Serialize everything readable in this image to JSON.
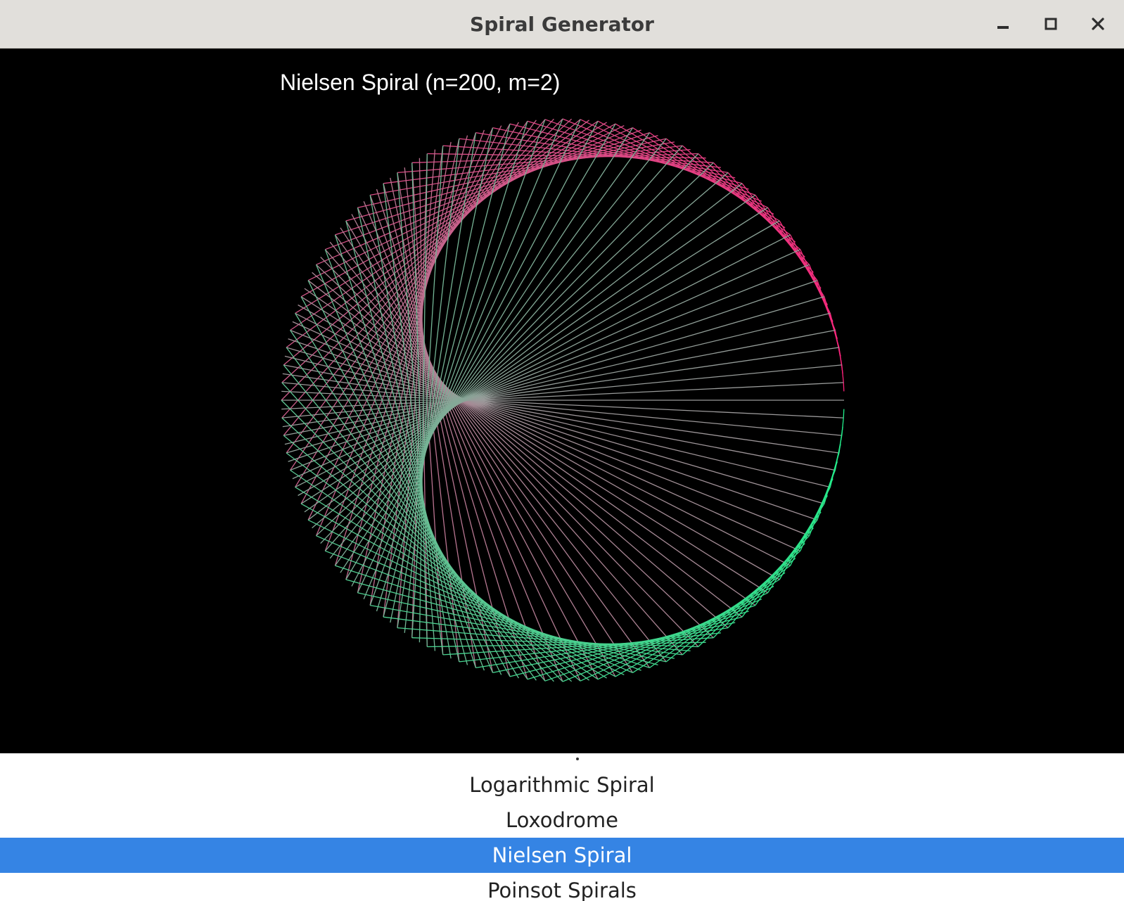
{
  "window": {
    "title": "Spiral Generator"
  },
  "window_controls": [
    "minimize",
    "maximize",
    "close"
  ],
  "canvas": {
    "title": "Nielsen Spiral (n=200, m=2)",
    "background": "#000000",
    "colors": {
      "upper": "#ff1f7a",
      "lower": "#1fef8a",
      "mid": "#9a9a9a"
    }
  },
  "list": {
    "items": [
      {
        "label": "Logarithmic Spiral",
        "selected": false
      },
      {
        "label": "Loxodrome",
        "selected": false
      },
      {
        "label": "Nielsen Spiral",
        "selected": true
      },
      {
        "label": "Poinsot Spirals",
        "selected": false
      }
    ],
    "selected_color": "#3584e4"
  }
}
